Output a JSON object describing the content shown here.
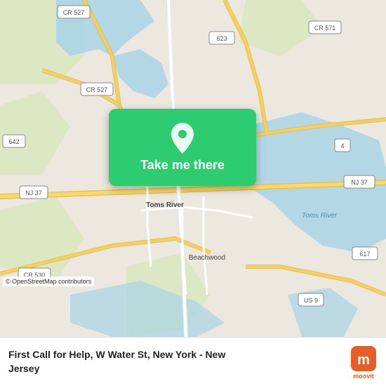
{
  "map": {
    "attribution": "© OpenStreetMap contributors",
    "overlay": {
      "button_label": "Take me there",
      "pin_icon": "location-pin"
    },
    "labels": {
      "toms_river": "Toms River",
      "beachwood": "Beachwood",
      "cr527_top": "CR 527",
      "cr527_mid": "CR 527",
      "cr571": "CR 571",
      "cr37": "NJ 37",
      "nj37_right": "NJ 37",
      "cr642": "642",
      "cr4": "4",
      "cr530": "CR 530",
      "cr617": "617",
      "us9": "US 9",
      "cr623": "623",
      "toms_river_water": "Toms River"
    }
  },
  "footer": {
    "location_line1": "First Call for Help, W Water St, New York - New",
    "location_line2": "Jersey"
  },
  "moovit": {
    "logo_text": "moovit"
  }
}
